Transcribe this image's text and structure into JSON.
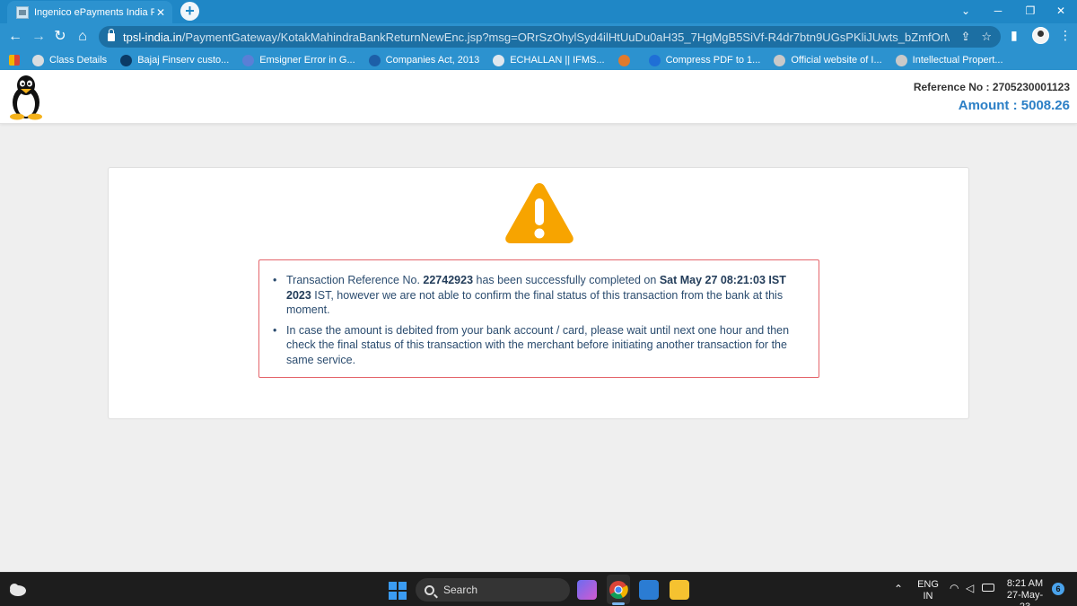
{
  "browser": {
    "tab_title": "Ingenico ePayments India Pvt. Ltd.",
    "tab_close": "✕",
    "new_tab": "+",
    "url_host": "tpsl-india.in",
    "url_path": "/PaymentGateway/KotakMahindraBankReturnNewEnc.jsp?msg=ORrSzOhylSyd4ilHtUuDu0aH35_7HgMgB5SiVf-R4dr7btn9UGsPKliJUwts_bZmfOrMTRWgZty1QW8nmfAQ-Nu0b-HF...",
    "bookmarks": [
      {
        "label": "Class Details",
        "color": "#d9dde0"
      },
      {
        "label": "Bajaj Finserv custo...",
        "color": "#0b3a66"
      },
      {
        "label": "Emsigner Error in G...",
        "color": "#5a7fd6"
      },
      {
        "label": "Companies Act, 2013",
        "color": "#1d5fa8"
      },
      {
        "label": "ECHALLAN || IFMS...",
        "color": "#dfe7ee"
      },
      {
        "label": "",
        "color": "#e07a2d"
      },
      {
        "label": "Compress PDF to 1...",
        "color": "#1f6fd6"
      },
      {
        "label": "Official website of I...",
        "color": "#c9c9c9"
      },
      {
        "label": "Intellectual Propert...",
        "color": "#c9c9c9"
      }
    ]
  },
  "header": {
    "reference_label": "Reference No :",
    "reference_value": "2705230001123",
    "amount_label": "Amount :",
    "amount_value": "5008.26"
  },
  "message": {
    "line1_a": "Transaction Reference No.",
    "txn_ref": "22742923",
    "line1_b": "has been successfully completed on",
    "txn_date": "Sat May 27 08:21:03 IST 2023",
    "line1_c": "IST, however we are not able to confirm the final status of this transaction from the bank at this moment.",
    "line2": "In case the amount is debited from your bank account / card, please wait until next one hour and then check the final status of this transaction with the merchant before initiating another transaction for the same service."
  },
  "taskbar": {
    "search_label": "Search",
    "lang_top": "ENG",
    "lang_bottom": "IN",
    "time": "8:21 AM",
    "date": "27-May-23",
    "notification_count": "6"
  },
  "colors": {
    "browser_accent": "#2c92cf",
    "amount": "#2b7fc6",
    "warning": "#f7a400",
    "alert_border": "#e4656b"
  }
}
